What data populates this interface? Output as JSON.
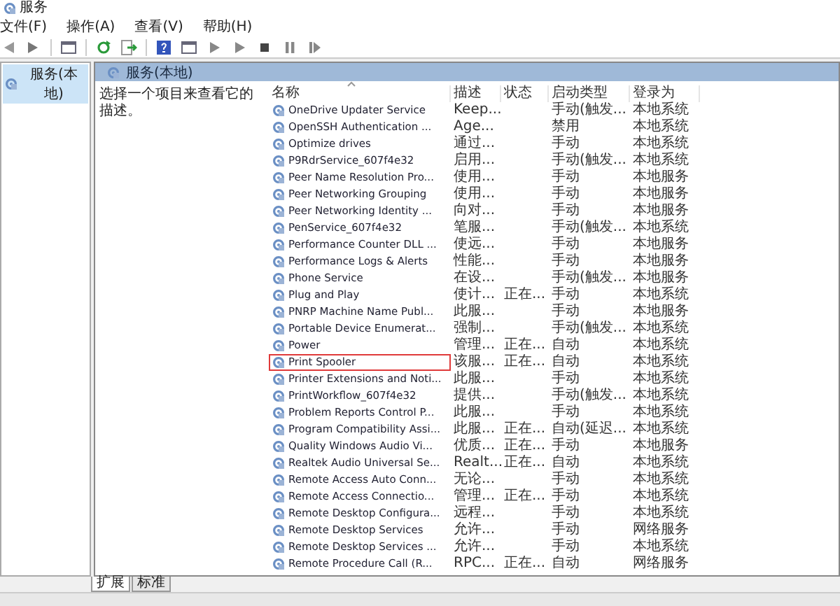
{
  "window": {
    "title": "服务"
  },
  "menu": [
    "文件(F)",
    "操作(A)",
    "查看(V)",
    "帮助(H)"
  ],
  "tree": [
    {
      "label": "服务(本地)",
      "selected": true
    }
  ],
  "panel": {
    "title": "服务(本地)",
    "description": "选择一个项目来查看它的描述。",
    "columns": [
      "名称",
      "描述",
      "状态",
      "启动类型",
      "登录为"
    ],
    "rows": [
      {
        "name": "OneDrive Updater Service",
        "description": "Keep...",
        "status": "",
        "startup": "手动(触发...",
        "logon": "本地系统",
        "highlighted": false
      },
      {
        "name": "OpenSSH Authentication ...",
        "description": "Age...",
        "status": "",
        "startup": "禁用",
        "logon": "本地系统",
        "highlighted": false
      },
      {
        "name": "Optimize drives",
        "description": "通过...",
        "status": "",
        "startup": "手动",
        "logon": "本地系统",
        "highlighted": false
      },
      {
        "name": "P9RdrService_607f4e32",
        "description": "启用...",
        "status": "",
        "startup": "手动(触发...",
        "logon": "本地系统",
        "highlighted": false
      },
      {
        "name": "Peer Name Resolution Pro...",
        "description": "使用...",
        "status": "",
        "startup": "手动",
        "logon": "本地服务",
        "highlighted": false
      },
      {
        "name": "Peer Networking Grouping",
        "description": "使用...",
        "status": "",
        "startup": "手动",
        "logon": "本地服务",
        "highlighted": false
      },
      {
        "name": "Peer Networking Identity ...",
        "description": "向对...",
        "status": "",
        "startup": "手动",
        "logon": "本地服务",
        "highlighted": false
      },
      {
        "name": "PenService_607f4e32",
        "description": "笔服...",
        "status": "",
        "startup": "手动(触发...",
        "logon": "本地系统",
        "highlighted": false
      },
      {
        "name": "Performance Counter DLL ...",
        "description": "使远...",
        "status": "",
        "startup": "手动",
        "logon": "本地服务",
        "highlighted": false
      },
      {
        "name": "Performance Logs & Alerts",
        "description": "性能...",
        "status": "",
        "startup": "手动",
        "logon": "本地服务",
        "highlighted": false
      },
      {
        "name": "Phone Service",
        "description": "在设...",
        "status": "",
        "startup": "手动(触发...",
        "logon": "本地服务",
        "highlighted": false
      },
      {
        "name": "Plug and Play",
        "description": "使计...",
        "status": "正在...",
        "startup": "手动",
        "logon": "本地系统",
        "highlighted": false
      },
      {
        "name": "PNRP Machine Name Publ...",
        "description": "此服...",
        "status": "",
        "startup": "手动",
        "logon": "本地服务",
        "highlighted": false
      },
      {
        "name": "Portable Device Enumerat...",
        "description": "强制...",
        "status": "",
        "startup": "手动(触发...",
        "logon": "本地系统",
        "highlighted": false
      },
      {
        "name": "Power",
        "description": "管理...",
        "status": "正在...",
        "startup": "自动",
        "logon": "本地系统",
        "highlighted": false
      },
      {
        "name": "Print Spooler",
        "description": "该服...",
        "status": "正在...",
        "startup": "自动",
        "logon": "本地系统",
        "highlighted": true
      },
      {
        "name": "Printer Extensions and Noti...",
        "description": "此服...",
        "status": "",
        "startup": "手动",
        "logon": "本地系统",
        "highlighted": false
      },
      {
        "name": "PrintWorkflow_607f4e32",
        "description": "提供...",
        "status": "",
        "startup": "手动(触发...",
        "logon": "本地系统",
        "highlighted": false
      },
      {
        "name": "Problem Reports Control P...",
        "description": "此服...",
        "status": "",
        "startup": "手动",
        "logon": "本地系统",
        "highlighted": false
      },
      {
        "name": "Program Compatibility Assi...",
        "description": "此服...",
        "status": "正在...",
        "startup": "自动(延迟...",
        "logon": "本地系统",
        "highlighted": false
      },
      {
        "name": "Quality Windows Audio Vi...",
        "description": "优质...",
        "status": "正在...",
        "startup": "手动",
        "logon": "本地服务",
        "highlighted": false
      },
      {
        "name": "Realtek Audio Universal Se...",
        "description": "Realt...",
        "status": "正在...",
        "startup": "自动",
        "logon": "本地系统",
        "highlighted": false
      },
      {
        "name": "Remote Access Auto Conn...",
        "description": "无论...",
        "status": "",
        "startup": "手动",
        "logon": "本地系统",
        "highlighted": false
      },
      {
        "name": "Remote Access Connectio...",
        "description": "管理...",
        "status": "正在...",
        "startup": "手动",
        "logon": "本地系统",
        "highlighted": false
      },
      {
        "name": "Remote Desktop Configura...",
        "description": "远程...",
        "status": "",
        "startup": "手动",
        "logon": "本地系统",
        "highlighted": false
      },
      {
        "name": "Remote Desktop Services",
        "description": "允许...",
        "status": "",
        "startup": "手动",
        "logon": "网络服务",
        "highlighted": false
      },
      {
        "name": "Remote Desktop Services ...",
        "description": "允许...",
        "status": "",
        "startup": "手动",
        "logon": "本地系统",
        "highlighted": false
      },
      {
        "name": "Remote Procedure Call (R...",
        "description": "RPC...",
        "status": "正在...",
        "startup": "自动",
        "logon": "网络服务",
        "highlighted": false
      }
    ]
  },
  "tabs": [
    {
      "label": "扩展",
      "selected": true
    },
    {
      "label": "标准",
      "selected": false
    }
  ]
}
